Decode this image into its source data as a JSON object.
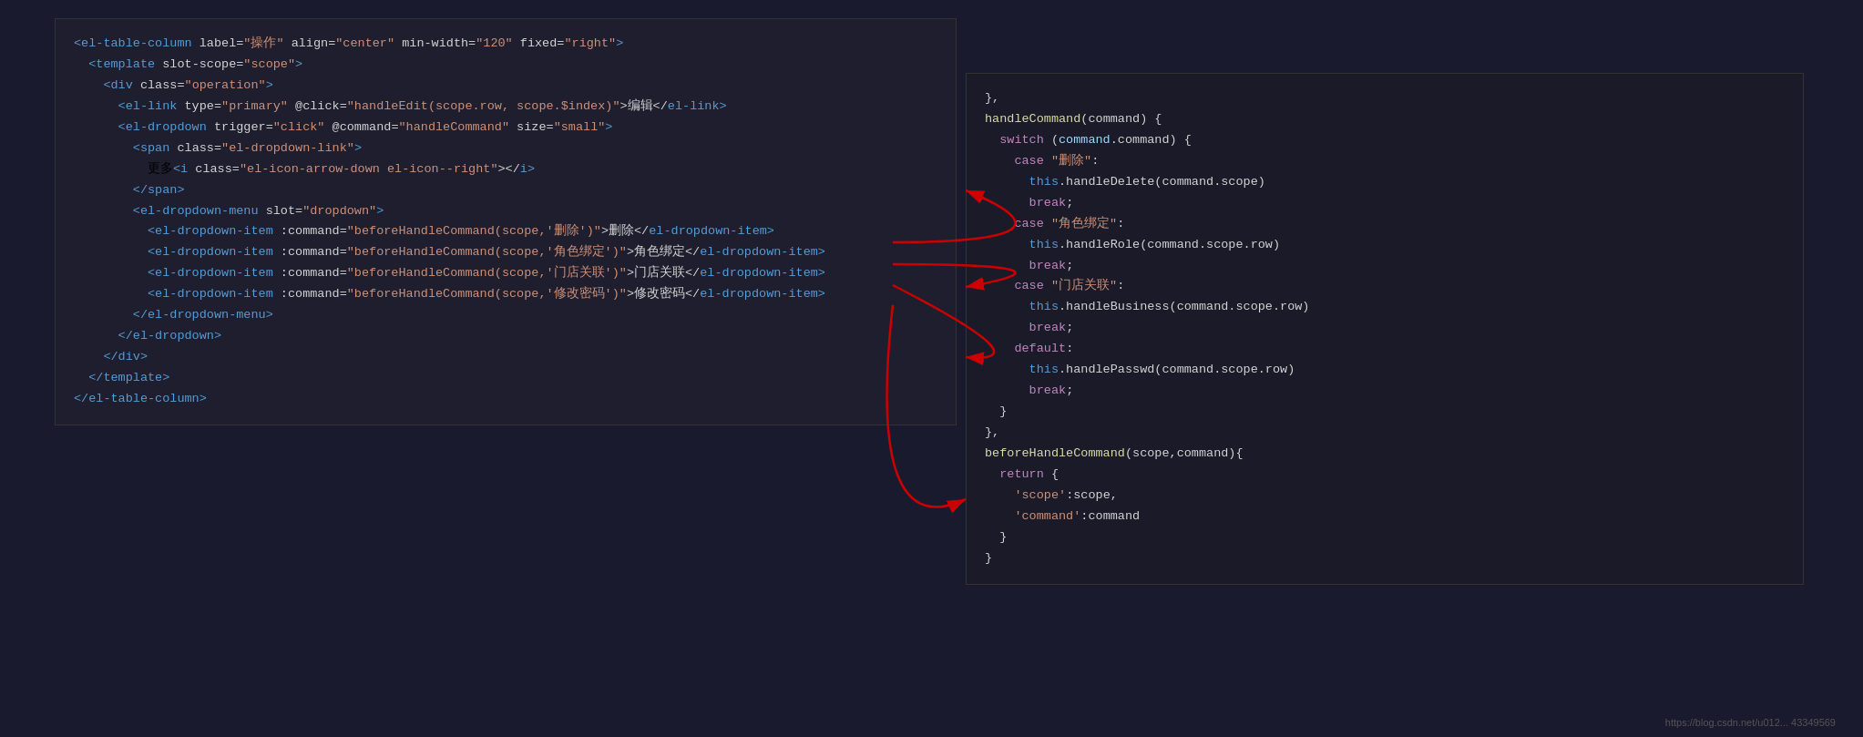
{
  "left_panel": {
    "lines": [
      {
        "id": "l1",
        "indent": 0,
        "parts": [
          {
            "text": "<",
            "cls": "c-tag"
          },
          {
            "text": "el-table-column",
            "cls": "c-tag"
          },
          {
            "text": " label=",
            "cls": "c-white"
          },
          {
            "text": "\"操作\"",
            "cls": "c-val"
          },
          {
            "text": " align=",
            "cls": "c-white"
          },
          {
            "text": "\"center\"",
            "cls": "c-val"
          },
          {
            "text": " min-width=",
            "cls": "c-white"
          },
          {
            "text": "\"120\"",
            "cls": "c-val"
          },
          {
            "text": " fixed=",
            "cls": "c-white"
          },
          {
            "text": "\"right\"",
            "cls": "c-val"
          },
          {
            "text": ">",
            "cls": "c-tag"
          }
        ]
      },
      {
        "id": "l2",
        "indent": 2,
        "parts": [
          {
            "text": "<",
            "cls": "c-tag"
          },
          {
            "text": "template",
            "cls": "c-tag"
          },
          {
            "text": " slot-scope=",
            "cls": "c-white"
          },
          {
            "text": "\"scope\"",
            "cls": "c-val"
          },
          {
            "text": ">",
            "cls": "c-tag"
          }
        ]
      },
      {
        "id": "l3",
        "indent": 4,
        "parts": [
          {
            "text": "<",
            "cls": "c-tag"
          },
          {
            "text": "div",
            "cls": "c-tag"
          },
          {
            "text": " class=",
            "cls": "c-white"
          },
          {
            "text": "\"operation\"",
            "cls": "c-val"
          },
          {
            "text": ">",
            "cls": "c-tag"
          }
        ]
      },
      {
        "id": "l4",
        "indent": 6,
        "parts": [
          {
            "text": "<",
            "cls": "c-tag"
          },
          {
            "text": "el-link",
            "cls": "c-tag"
          },
          {
            "text": " type=",
            "cls": "c-white"
          },
          {
            "text": "\"primary\"",
            "cls": "c-val"
          },
          {
            "text": " @click=",
            "cls": "c-white"
          },
          {
            "text": "\"handleEdit(scope.row, scope.$index)\"",
            "cls": "c-val"
          },
          {
            "text": ">编辑</",
            "cls": "c-white"
          },
          {
            "text": "el-link",
            "cls": "c-tag"
          },
          {
            "text": ">",
            "cls": "c-tag"
          }
        ]
      },
      {
        "id": "l5",
        "indent": 6,
        "parts": [
          {
            "text": "<",
            "cls": "c-tag"
          },
          {
            "text": "el-dropdown",
            "cls": "c-tag"
          },
          {
            "text": " trigger=",
            "cls": "c-white"
          },
          {
            "text": "\"click\"",
            "cls": "c-val"
          },
          {
            "text": " @command=",
            "cls": "c-white"
          },
          {
            "text": "\"handleCommand\"",
            "cls": "c-val"
          },
          {
            "text": " size=",
            "cls": "c-white"
          },
          {
            "text": "\"small\"",
            "cls": "c-val"
          },
          {
            "text": ">",
            "cls": "c-tag"
          }
        ]
      },
      {
        "id": "l6",
        "indent": 8,
        "parts": [
          {
            "text": "<",
            "cls": "c-tag"
          },
          {
            "text": "span",
            "cls": "c-tag"
          },
          {
            "text": " class=",
            "cls": "c-white"
          },
          {
            "text": "\"el-dropdown-link\"",
            "cls": "c-val"
          },
          {
            "text": ">",
            "cls": "c-tag"
          }
        ]
      },
      {
        "id": "l7",
        "indent": 10,
        "parts": [
          {
            "text": "更多<",
            "cls": "c-white"
          },
          {
            "text": "i",
            "cls": "c-tag"
          },
          {
            "text": " class=",
            "cls": "c-white"
          },
          {
            "text": "\"el-icon-arrow-down el-icon--right\"",
            "cls": "c-val"
          },
          {
            "text": "></",
            "cls": "c-white"
          },
          {
            "text": "i",
            "cls": "c-tag"
          },
          {
            "text": ">",
            "cls": "c-tag"
          }
        ]
      },
      {
        "id": "l8",
        "indent": 8,
        "parts": [
          {
            "text": "</",
            "cls": "c-tag"
          },
          {
            "text": "span",
            "cls": "c-tag"
          },
          {
            "text": ">",
            "cls": "c-tag"
          }
        ]
      },
      {
        "id": "l9",
        "indent": 8,
        "parts": [
          {
            "text": "<",
            "cls": "c-tag"
          },
          {
            "text": "el-dropdown-menu",
            "cls": "c-tag"
          },
          {
            "text": " slot=",
            "cls": "c-white"
          },
          {
            "text": "\"dropdown\"",
            "cls": "c-val"
          },
          {
            "text": ">",
            "cls": "c-tag"
          }
        ]
      },
      {
        "id": "l10",
        "indent": 10,
        "parts": [
          {
            "text": "<",
            "cls": "c-tag"
          },
          {
            "text": "el-dropdown-item",
            "cls": "c-tag"
          },
          {
            "text": " :command=",
            "cls": "c-white"
          },
          {
            "text": "\"beforeHandleCommand(scope,'删除')\"",
            "cls": "c-val"
          },
          {
            "text": ">删除</",
            "cls": "c-white"
          },
          {
            "text": "el-dropdown-item",
            "cls": "c-tag"
          },
          {
            "text": ">",
            "cls": "c-tag"
          }
        ]
      },
      {
        "id": "l11",
        "indent": 10,
        "parts": [
          {
            "text": "<",
            "cls": "c-tag"
          },
          {
            "text": "el-dropdown-item",
            "cls": "c-tag"
          },
          {
            "text": " :command=",
            "cls": "c-white"
          },
          {
            "text": "\"beforeHandleCommand(scope,'角色绑定')\"",
            "cls": "c-val"
          },
          {
            "text": ">角色绑定</",
            "cls": "c-white"
          },
          {
            "text": "el-dropdown-item",
            "cls": "c-tag"
          },
          {
            "text": ">",
            "cls": "c-tag"
          }
        ]
      },
      {
        "id": "l12",
        "indent": 10,
        "parts": [
          {
            "text": "<",
            "cls": "c-tag"
          },
          {
            "text": "el-dropdown-item",
            "cls": "c-tag"
          },
          {
            "text": " :command=",
            "cls": "c-white"
          },
          {
            "text": "\"beforeHandleCommand(scope,'门店关联')\"",
            "cls": "c-val"
          },
          {
            "text": ">门店关联</",
            "cls": "c-white"
          },
          {
            "text": "el-dropdown-item",
            "cls": "c-tag"
          },
          {
            "text": ">",
            "cls": "c-tag"
          }
        ]
      },
      {
        "id": "l13",
        "indent": 10,
        "parts": [
          {
            "text": "<",
            "cls": "c-tag"
          },
          {
            "text": "el-dropdown-item",
            "cls": "c-tag"
          },
          {
            "text": " :command=",
            "cls": "c-white"
          },
          {
            "text": "\"beforeHandleCommand(scope,'修改密码')\"",
            "cls": "c-val"
          },
          {
            "text": ">修改密码</",
            "cls": "c-white"
          },
          {
            "text": "el-dropdown-item",
            "cls": "c-tag"
          },
          {
            "text": ">",
            "cls": "c-tag"
          }
        ]
      },
      {
        "id": "l14",
        "indent": 8,
        "parts": [
          {
            "text": "</",
            "cls": "c-tag"
          },
          {
            "text": "el-dropdown-menu",
            "cls": "c-tag"
          },
          {
            "text": ">",
            "cls": "c-tag"
          }
        ]
      },
      {
        "id": "l15",
        "indent": 6,
        "parts": [
          {
            "text": "</",
            "cls": "c-tag"
          },
          {
            "text": "el-dropdown",
            "cls": "c-tag"
          },
          {
            "text": ">",
            "cls": "c-tag"
          }
        ]
      },
      {
        "id": "l16",
        "indent": 4,
        "parts": [
          {
            "text": "</",
            "cls": "c-tag"
          },
          {
            "text": "div",
            "cls": "c-tag"
          },
          {
            "text": ">",
            "cls": "c-tag"
          }
        ]
      },
      {
        "id": "l17",
        "indent": 2,
        "parts": [
          {
            "text": "</",
            "cls": "c-tag"
          },
          {
            "text": "template",
            "cls": "c-tag"
          },
          {
            "text": ">",
            "cls": "c-tag"
          }
        ]
      },
      {
        "id": "l18",
        "indent": 0,
        "parts": [
          {
            "text": "</",
            "cls": "c-tag"
          },
          {
            "text": "el-table-column",
            "cls": "c-tag"
          },
          {
            "text": ">",
            "cls": "c-tag"
          }
        ]
      }
    ]
  },
  "right_panel": {
    "lines": [
      {
        "text": "},",
        "parts": [
          {
            "text": "},",
            "cls": "c-white"
          }
        ]
      },
      {
        "text": "handleCommand(command) {",
        "parts": [
          {
            "text": "handleCommand",
            "cls": "c-yellow"
          },
          {
            "text": "(command) {",
            "cls": "c-white"
          }
        ]
      },
      {
        "text": "  switch (command.command) {",
        "parts": [
          {
            "text": "  ",
            "cls": "c-white"
          },
          {
            "text": "switch",
            "cls": "c-purple"
          },
          {
            "text": " (",
            "cls": "c-white"
          },
          {
            "text": "command",
            "cls": "c-var"
          },
          {
            "text": ".command) {",
            "cls": "c-white"
          }
        ]
      },
      {
        "text": "    case \"删除\":",
        "parts": [
          {
            "text": "    ",
            "cls": "c-white"
          },
          {
            "text": "case",
            "cls": "c-purple"
          },
          {
            "text": " ",
            "cls": "c-white"
          },
          {
            "text": "\"删除\"",
            "cls": "c-string"
          },
          {
            "text": ":",
            "cls": "c-white"
          }
        ]
      },
      {
        "text": "      this.handleDelete(command.scope)",
        "parts": [
          {
            "text": "      ",
            "cls": "c-white"
          },
          {
            "text": "this",
            "cls": "c-blue"
          },
          {
            "text": ".handleDelete(command.scope)",
            "cls": "c-white"
          }
        ]
      },
      {
        "text": "      break;",
        "parts": [
          {
            "text": "      ",
            "cls": "c-white"
          },
          {
            "text": "break",
            "cls": "c-purple"
          },
          {
            "text": ";",
            "cls": "c-white"
          }
        ]
      },
      {
        "text": "    case \"角色绑定\":",
        "parts": [
          {
            "text": "    ",
            "cls": "c-white"
          },
          {
            "text": "case",
            "cls": "c-purple"
          },
          {
            "text": " ",
            "cls": "c-white"
          },
          {
            "text": "\"角色绑定\"",
            "cls": "c-string"
          },
          {
            "text": ":",
            "cls": "c-white"
          }
        ]
      },
      {
        "text": "      this.handleRole(command.scope.row)",
        "parts": [
          {
            "text": "      ",
            "cls": "c-white"
          },
          {
            "text": "this",
            "cls": "c-blue"
          },
          {
            "text": ".handleRole(command.scope.row)",
            "cls": "c-white"
          }
        ]
      },
      {
        "text": "      break;",
        "parts": [
          {
            "text": "      ",
            "cls": "c-white"
          },
          {
            "text": "break",
            "cls": "c-purple"
          },
          {
            "text": ";",
            "cls": "c-white"
          }
        ]
      },
      {
        "text": "    case \"门店关联\":",
        "parts": [
          {
            "text": "    ",
            "cls": "c-white"
          },
          {
            "text": "case",
            "cls": "c-purple"
          },
          {
            "text": " ",
            "cls": "c-white"
          },
          {
            "text": "\"门店关联\"",
            "cls": "c-string"
          },
          {
            "text": ":",
            "cls": "c-white"
          }
        ]
      },
      {
        "text": "      this.handleBusiness(command.scope.row)",
        "parts": [
          {
            "text": "      ",
            "cls": "c-white"
          },
          {
            "text": "this",
            "cls": "c-blue"
          },
          {
            "text": ".handleBusiness(command.scope.row)",
            "cls": "c-white"
          }
        ]
      },
      {
        "text": "      break;",
        "parts": [
          {
            "text": "      ",
            "cls": "c-white"
          },
          {
            "text": "break",
            "cls": "c-purple"
          },
          {
            "text": ";",
            "cls": "c-white"
          }
        ]
      },
      {
        "text": "    default:",
        "parts": [
          {
            "text": "    ",
            "cls": "c-white"
          },
          {
            "text": "default",
            "cls": "c-purple"
          },
          {
            "text": ":",
            "cls": "c-white"
          }
        ]
      },
      {
        "text": "      this.handlePasswd(command.scope.row)",
        "parts": [
          {
            "text": "      ",
            "cls": "c-white"
          },
          {
            "text": "this",
            "cls": "c-blue"
          },
          {
            "text": ".handlePasswd(command.scope.row)",
            "cls": "c-white"
          }
        ]
      },
      {
        "text": "      break;",
        "parts": [
          {
            "text": "      ",
            "cls": "c-white"
          },
          {
            "text": "break",
            "cls": "c-purple"
          },
          {
            "text": ";",
            "cls": "c-white"
          }
        ]
      },
      {
        "text": "  }",
        "parts": [
          {
            "text": "  }",
            "cls": "c-white"
          }
        ]
      },
      {
        "text": "},",
        "parts": [
          {
            "text": "},",
            "cls": "c-white"
          }
        ]
      },
      {
        "text": "beforeHandleCommand(scope,command){",
        "parts": [
          {
            "text": "beforeHandleCommand",
            "cls": "c-yellow"
          },
          {
            "text": "(scope,command){",
            "cls": "c-white"
          }
        ]
      },
      {
        "text": "  return {",
        "parts": [
          {
            "text": "  ",
            "cls": "c-white"
          },
          {
            "text": "return",
            "cls": "c-purple"
          },
          {
            "text": " {",
            "cls": "c-white"
          }
        ]
      },
      {
        "text": "    'scope':scope,",
        "parts": [
          {
            "text": "    ",
            "cls": "c-white"
          },
          {
            "text": "'scope'",
            "cls": "c-string"
          },
          {
            "text": ":scope,",
            "cls": "c-white"
          }
        ]
      },
      {
        "text": "    'command':command",
        "parts": [
          {
            "text": "    ",
            "cls": "c-white"
          },
          {
            "text": "'command'",
            "cls": "c-string"
          },
          {
            "text": ":command",
            "cls": "c-white"
          }
        ]
      },
      {
        "text": "  }",
        "parts": [
          {
            "text": "  }",
            "cls": "c-white"
          }
        ]
      },
      {
        "text": "}",
        "parts": [
          {
            "text": "}",
            "cls": "c-white"
          }
        ]
      }
    ]
  },
  "watermark": "https://blog.csdn.net/u012... 43349569"
}
